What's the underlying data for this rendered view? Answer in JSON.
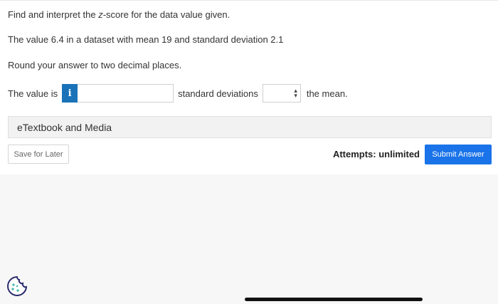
{
  "question": {
    "line1_prefix": "Find and interpret the ",
    "line1_italic": "z",
    "line1_suffix": "-score for the data value given.",
    "line2": "The value 6.4 in a dataset with mean 19 and standard deviation 2.1",
    "line3": "Round your answer to two decimal places."
  },
  "answer": {
    "prefix": "The value is",
    "info_glyph": "i",
    "input_value": "",
    "middle_text": "standard deviations",
    "select_value": "",
    "suffix": "the mean."
  },
  "media": {
    "label": "eTextbook and Media"
  },
  "footer": {
    "save_label": "Save for Later",
    "attempts": "Attempts: unlimited",
    "submit_label": "Submit Answer"
  },
  "colors": {
    "accent": "#1a73e8",
    "info": "#1a73b9"
  },
  "icons": {
    "info": "info-icon",
    "select": "chevron-updown-icon",
    "cookie": "cookie-icon"
  }
}
